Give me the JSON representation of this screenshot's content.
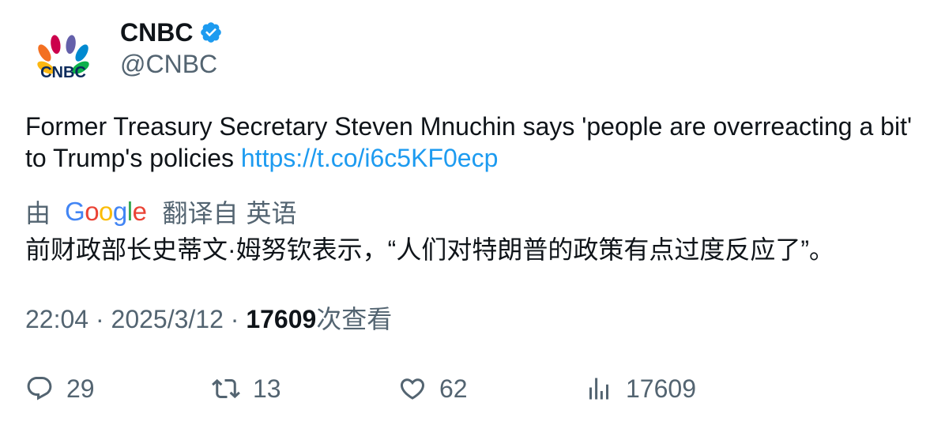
{
  "author": {
    "display_name": "CNBC",
    "handle": "@CNBC",
    "logo_text": "CNBC",
    "verified_color": "#1d9bf0"
  },
  "tweet": {
    "text": "Former Treasury Secretary Steven Mnuchin says 'people are overreacting a bit' to Trump's policies ",
    "link": "https://t.co/i6c5KF0ecp"
  },
  "translation": {
    "by_label": "由",
    "provider": [
      "G",
      "o",
      "o",
      "g",
      "l",
      "e"
    ],
    "from_label": "翻译自",
    "language": "英语",
    "text": "前财政部长史蒂文·姆努钦表示，“人们对特朗普的政策有点过度反应了”。"
  },
  "meta": {
    "time": "22:04",
    "separator": " · ",
    "date": "2025/3/12",
    "views_count": "17609",
    "views_label": "次查看"
  },
  "actions": {
    "replies": "29",
    "retweets": "13",
    "likes": "62",
    "views": "17609"
  },
  "colors": {
    "text": "#0f1419",
    "secondary": "#536471",
    "link": "#1d9bf0"
  }
}
